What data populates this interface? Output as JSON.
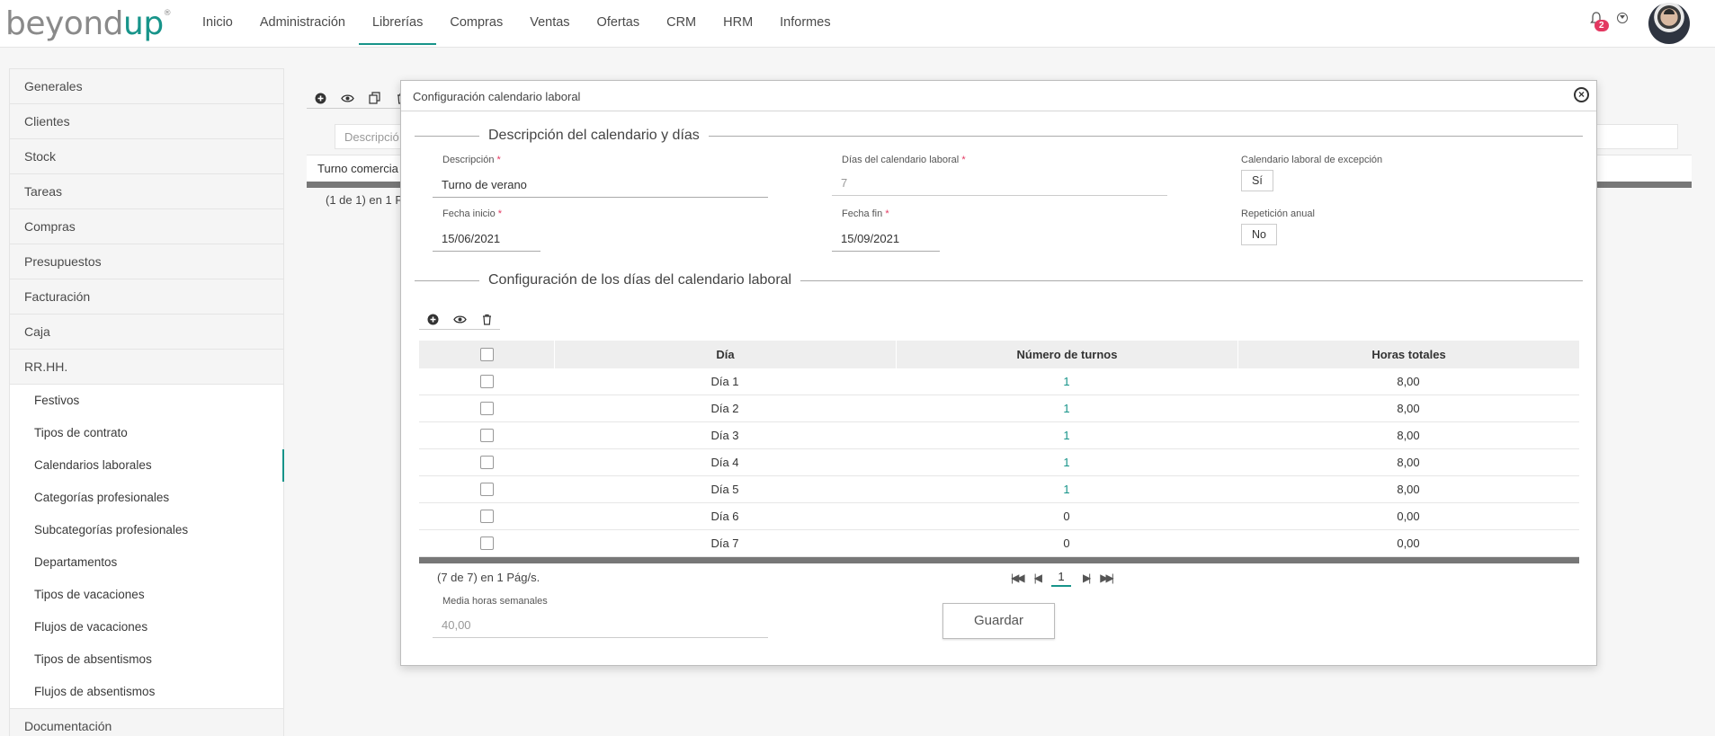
{
  "app": {
    "logo_left": "beyond",
    "logo_right": "up",
    "logo_mark": "®",
    "nav": [
      "Inicio",
      "Administración",
      "Librerías",
      "Compras",
      "Ventas",
      "Ofertas",
      "CRM",
      "HRM",
      "Informes"
    ],
    "active_nav": "Librerías",
    "notification_count": "2",
    "accent_color": "#17948a",
    "badge_color": "#e33861"
  },
  "sidebar": {
    "items": [
      "Generales",
      "Clientes",
      "Stock",
      "Tareas",
      "Compras",
      "Presupuestos",
      "Facturación",
      "Caja",
      "RR.HH."
    ],
    "subitems": [
      "Festivos",
      "Tipos de contrato",
      "Calendarios laborales",
      "Categorías profesionales",
      "Subcategorías profesionales",
      "Departamentos",
      "Tipos de vacaciones",
      "Flujos de vacaciones",
      "Tipos de absentismos",
      "Flujos de absentismos"
    ],
    "active_subitem": "Calendarios laborales",
    "last_item": "Documentación"
  },
  "background": {
    "search_placeholder": "Descripció",
    "row_text": "Turno comercia",
    "pagination": "(1 de 1) en 1 P"
  },
  "modal": {
    "title": "Configuración calendario laboral",
    "section1": "Descripción del calendario y días",
    "section2": "Configuración de los días del calendario laboral",
    "fields": {
      "descripcion_label": "Descripción",
      "descripcion_value": "Turno de verano",
      "dias_label": "Días del calendario laboral",
      "dias_value": "7",
      "excepcion_label": "Calendario laboral de excepción",
      "excepcion_value": "Sí",
      "fecha_inicio_label": "Fecha inicio",
      "fecha_inicio_value": "15/06/2021",
      "fecha_fin_label": "Fecha fin",
      "fecha_fin_value": "15/09/2021",
      "repeticion_label": "Repetición anual",
      "repeticion_value": "No",
      "media_label": "Media horas semanales",
      "media_value": "40,00",
      "required_mark": "*"
    },
    "grid": {
      "headers": [
        "Día",
        "Número de turnos",
        "Horas totales"
      ],
      "rows": [
        [
          "Día 1",
          "1",
          "8,00"
        ],
        [
          "Día 2",
          "1",
          "8,00"
        ],
        [
          "Día 3",
          "1",
          "8,00"
        ],
        [
          "Día 4",
          "1",
          "8,00"
        ],
        [
          "Día 5",
          "1",
          "8,00"
        ],
        [
          "Día 6",
          "0",
          "0,00"
        ],
        [
          "Día 7",
          "0",
          "0,00"
        ]
      ],
      "pagination": "(7 de 7) en 1 Pág/s.",
      "page": "1"
    },
    "save_label": "Guardar"
  }
}
